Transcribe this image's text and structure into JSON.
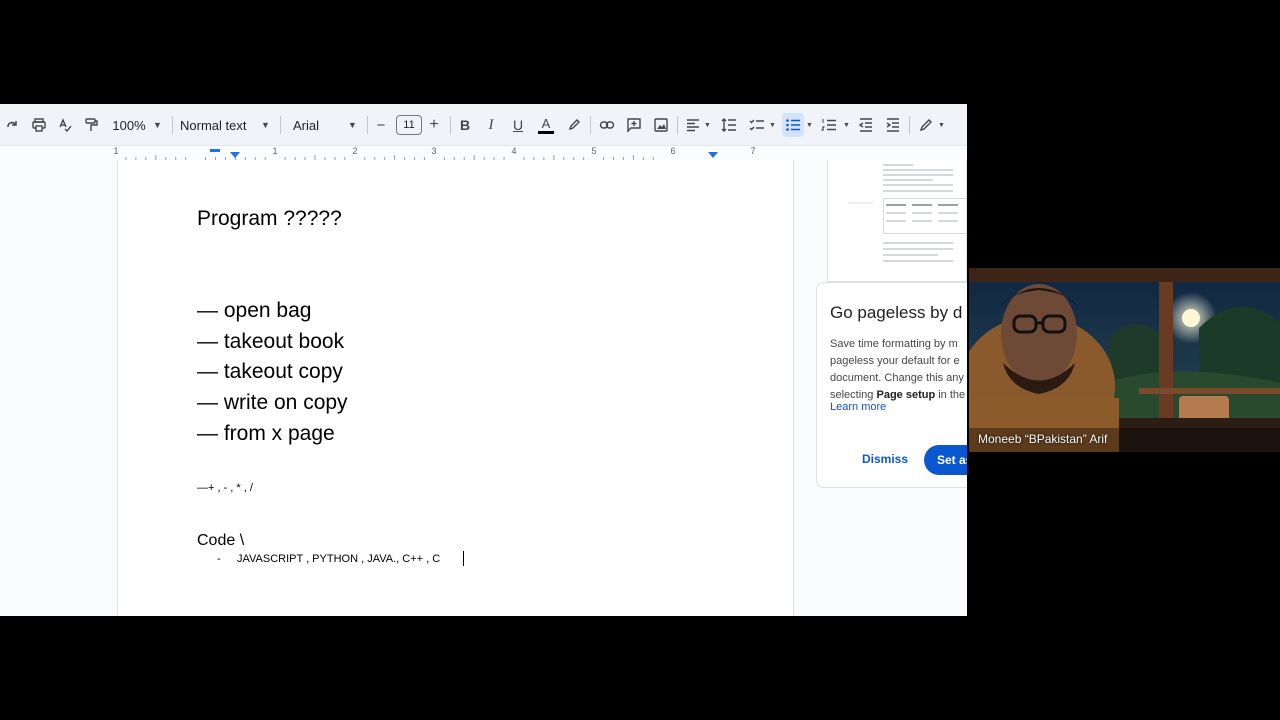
{
  "toolbar": {
    "zoom": "100%",
    "style": "Normal text",
    "font": "Arial",
    "font_size": "11",
    "minus": "−",
    "plus": "+",
    "bold": "B",
    "italic": "I",
    "underline": "U",
    "text_color_letter": "A",
    "icons": [
      "redo-icon",
      "print-icon",
      "spellcheck-icon",
      "paint-format-icon",
      "link-icon",
      "comment-icon",
      "image-icon",
      "align-icon",
      "line-spacing-icon",
      "checklist-icon",
      "bulleted-list-icon",
      "numbered-list-icon",
      "decrease-indent-icon",
      "increase-indent-icon",
      "edit-mode-icon"
    ]
  },
  "ruler": {
    "numbers": [
      "1",
      "1",
      "2",
      "3",
      "4",
      "5",
      "6",
      "7"
    ]
  },
  "document": {
    "title": "Program ?????",
    "bullets": [
      "— open bag",
      "— takeout book",
      "— takeout copy",
      "— write on copy",
      "— from x page"
    ],
    "operators": "—+ , - , * , /",
    "code_heading": "Code \\",
    "list_dash": "-",
    "languages": "JAVASCRIPT , PYTHON , JAVA., C++ , C"
  },
  "promo": {
    "title": "Go pageless by d",
    "lines": [
      "Save time formatting by m",
      "pageless your default for e",
      "document. Change this any"
    ],
    "last_prefix": "selecting ",
    "last_bold": "Page setup",
    "last_suffix": " in the",
    "learn_more": "Learn more",
    "dismiss": "Dismiss",
    "set_as": "Set as"
  },
  "webcam": {
    "participant_name": "Moneeb “BPakistan” Arif"
  },
  "colors": {
    "accent": "#0b57d0",
    "toolbar_bg": "#f0f4f9",
    "active_bg": "#d3e3fd"
  }
}
